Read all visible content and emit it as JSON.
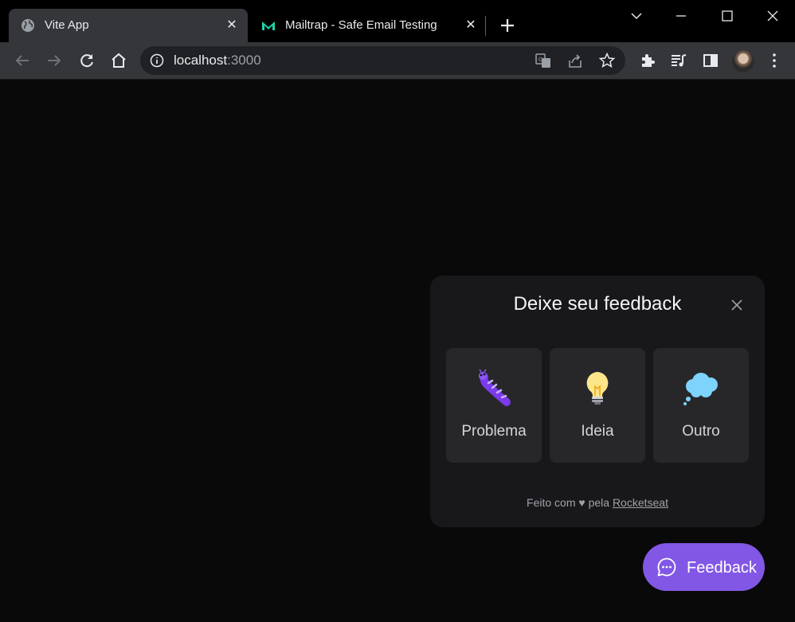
{
  "browser": {
    "tabs": [
      {
        "title": "Vite App",
        "favicon": "globe-icon"
      },
      {
        "title": "Mailtrap - Safe Email Testing",
        "favicon": "mailtrap-icon"
      }
    ],
    "address": {
      "host": "localhost",
      "port": ":3000"
    }
  },
  "widget": {
    "title": "Deixe seu feedback",
    "options": [
      {
        "label": "Problema",
        "icon": "bug-emoji-icon"
      },
      {
        "label": "Ideia",
        "icon": "lightbulb-emoji-icon"
      },
      {
        "label": "Outro",
        "icon": "thought-balloon-emoji-icon"
      }
    ],
    "footer": {
      "prefix": "Feito com ♥ pela ",
      "link": "Rocketseat"
    },
    "button_label": "Feedback"
  },
  "colors": {
    "accent": "#8257e5",
    "panel": "#18181b",
    "card": "#27272a",
    "page_bg": "#09090a"
  }
}
